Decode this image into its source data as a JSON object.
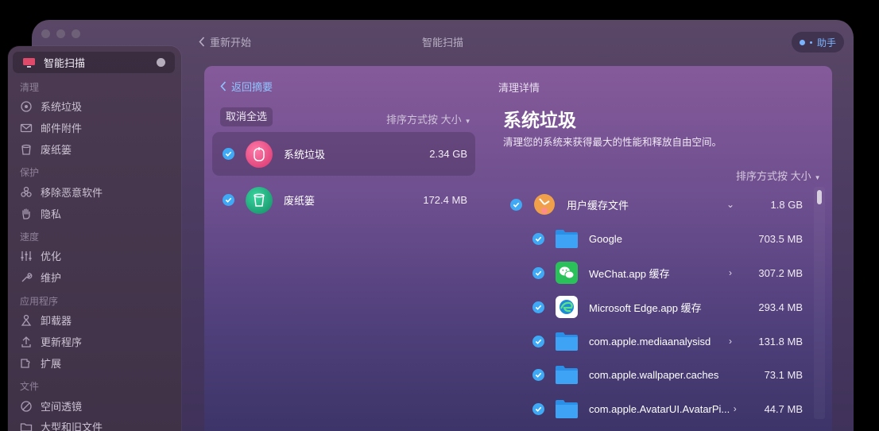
{
  "window": {
    "back_label": "重新开始",
    "title": "智能扫描",
    "assistant_label": "助手"
  },
  "sidebar": {
    "active": {
      "label": "智能扫描",
      "icon": "monitor-icon"
    },
    "sections": [
      {
        "title": "清理",
        "items": [
          {
            "label": "系统垃圾",
            "icon": "disc-icon"
          },
          {
            "label": "邮件附件",
            "icon": "mail-icon"
          },
          {
            "label": "废纸篓",
            "icon": "trash-icon"
          }
        ]
      },
      {
        "title": "保护",
        "items": [
          {
            "label": "移除恶意软件",
            "icon": "biohazard-icon"
          },
          {
            "label": "隐私",
            "icon": "hand-icon"
          }
        ]
      },
      {
        "title": "速度",
        "items": [
          {
            "label": "优化",
            "icon": "sliders-icon"
          },
          {
            "label": "维护",
            "icon": "wrench-icon"
          }
        ]
      },
      {
        "title": "应用程序",
        "items": [
          {
            "label": "卸载器",
            "icon": "uninstaller-icon"
          },
          {
            "label": "更新程序",
            "icon": "updater-icon"
          },
          {
            "label": "扩展",
            "icon": "extensions-icon"
          }
        ]
      },
      {
        "title": "文件",
        "items": [
          {
            "label": "空间透镜",
            "icon": "lens-icon"
          },
          {
            "label": "大型和旧文件",
            "icon": "folder-icon"
          }
        ]
      }
    ]
  },
  "main": {
    "back_summary": "返回摘要",
    "deselect_all": "取消全选",
    "sort_prefix": "排序方式按",
    "sort_value": "大小",
    "categories": [
      {
        "name": "系统垃圾",
        "size": "2.34 GB",
        "selected": true,
        "color": "#e6457d"
      },
      {
        "name": "废纸篓",
        "size": "172.4 MB",
        "selected": false,
        "color": "#1aa27a"
      }
    ],
    "detail": {
      "label": "清理详情",
      "title": "系统垃圾",
      "description": "清理您的系统来获得最大的性能和释放自由空间。",
      "sort_prefix": "排序方式按",
      "sort_value": "大小",
      "group": {
        "name": "用户缓存文件",
        "size": "1.8 GB",
        "icon": "user-cache-icon"
      },
      "items": [
        {
          "name": "Google",
          "size": "703.5 MB",
          "icon": "folder-icon",
          "has_children": false
        },
        {
          "name": "WeChat.app 缓存",
          "size": "307.2 MB",
          "icon": "wechat-icon",
          "has_children": true
        },
        {
          "name": "Microsoft Edge.app 缓存",
          "size": "293.4 MB",
          "icon": "edge-icon",
          "has_children": false
        },
        {
          "name": "com.apple.mediaanalysisd",
          "size": "131.8 MB",
          "icon": "folder-icon",
          "has_children": true
        },
        {
          "name": "com.apple.wallpaper.caches",
          "size": "73.1 MB",
          "icon": "folder-icon",
          "has_children": false
        },
        {
          "name": "com.apple.AvatarUI.AvatarPi...",
          "size": "44.7 MB",
          "icon": "folder-icon",
          "has_children": true
        }
      ]
    }
  },
  "colors": {
    "accent": "#3fa9f5",
    "link": "#8fc4ff",
    "folder": "#2b8fe8"
  }
}
